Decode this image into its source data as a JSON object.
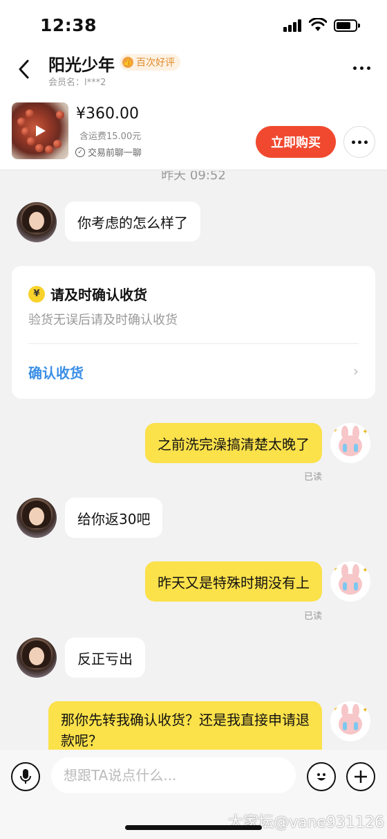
{
  "status_bar": {
    "time": "12:38"
  },
  "header": {
    "title": "阳光少年",
    "badge": "百次好评",
    "member": "会员名：l***2"
  },
  "product": {
    "price": "¥360.00",
    "shipping": "含运费15.00元",
    "chat_note": "交易前聊一聊",
    "buy_label": "立即购买"
  },
  "chat": {
    "timestamp": "昨天 09:52",
    "messages": [
      {
        "side": "left",
        "text": "你考虑的怎么样了"
      },
      {
        "side": "right",
        "text": "之前洗完澡搞清楚太晚了",
        "status": "已读"
      },
      {
        "side": "left",
        "text": "给你返30吧"
      },
      {
        "side": "right",
        "text": "昨天又是特殊时期没有上",
        "status": "已读"
      },
      {
        "side": "left",
        "text": "反正亏出"
      },
      {
        "side": "right",
        "text": "那你先转我确认收货？还是我直接申请退款呢？"
      }
    ],
    "card": {
      "title": "请及时确认收货",
      "subtitle": "验货无误后请及时确认收货",
      "action": "确认收货"
    }
  },
  "input": {
    "placeholder": "想跟TA说点什么..."
  },
  "watermark": "大家坛@vane931126",
  "colors": {
    "accent_yellow": "#fbe14a",
    "buy_red": "#f0492f",
    "link_blue": "#3a8ee6"
  }
}
